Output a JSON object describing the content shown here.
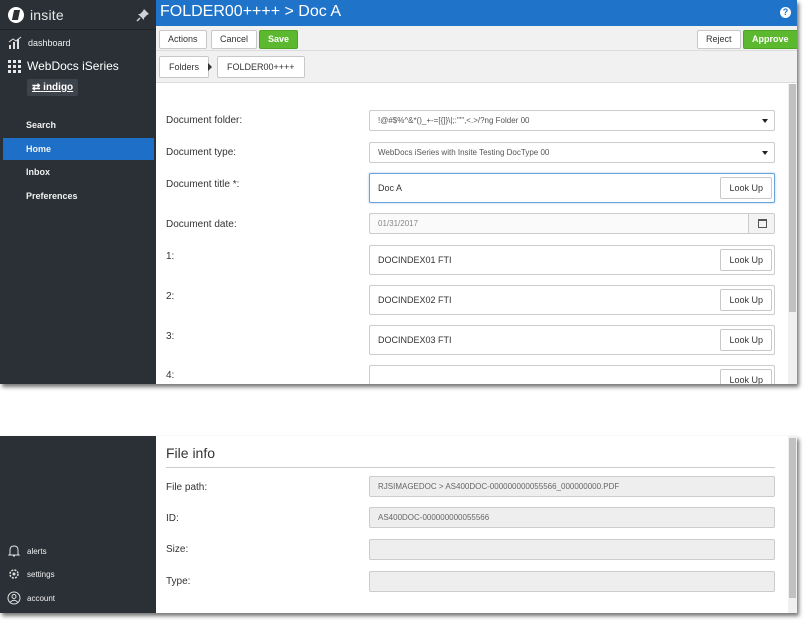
{
  "sidebar": {
    "logo_text": "insite",
    "dashboard_label": "dashboard",
    "app_name": "WebDocs iSeries",
    "environment": "indigo",
    "nav": [
      {
        "label": "Search"
      },
      {
        "label": "Home"
      },
      {
        "label": "Inbox"
      },
      {
        "label": "Preferences"
      }
    ],
    "bottom_nav": [
      {
        "label": "alerts",
        "icon": "bell-icon"
      },
      {
        "label": "settings",
        "icon": "gear-icon"
      },
      {
        "label": "account",
        "icon": "user-icon"
      }
    ]
  },
  "header": {
    "title": "FOLDER00++++ > Doc A",
    "help": "?"
  },
  "toolbar": {
    "actions_label": "Actions",
    "cancel_label": "Cancel",
    "save_label": "Save",
    "reject_label": "Reject",
    "approve_label": "Approve"
  },
  "breadcrumb": {
    "folders_label": "Folders",
    "current": "FOLDER00++++"
  },
  "form": {
    "folder_label": "Document folder:",
    "folder_value": "!@#$%^&*()_+-=[{]}\\|;:'\"\",<.>/?ng Folder 00",
    "type_label": "Document type:",
    "type_value": "WebDocs iSeries with Insite Testing DocType 00",
    "title_label": "Document title *:",
    "title_value": "Doc A",
    "date_label": "Document date:",
    "date_value": "01/31/2017",
    "lookup_label": "Look Up",
    "indexes": [
      {
        "label": "1:",
        "value": "DOCINDEX01 FTI"
      },
      {
        "label": "2:",
        "value": "DOCINDEX02 FTI"
      },
      {
        "label": "3:",
        "value": "DOCINDEX03 FTI"
      },
      {
        "label": "4:",
        "value": ""
      }
    ]
  },
  "file_info": {
    "title": "File info",
    "path_label": "File path:",
    "path_value": "RJSIMAGEDOC > AS400DOC-000000000055566_000000000.PDF",
    "id_label": "ID:",
    "id_value": "AS400DOC-000000000055566",
    "size_label": "Size:",
    "size_value": "",
    "type_label": "Type:",
    "type_value": ""
  },
  "colors": {
    "header_blue": "#1f73c9",
    "sidebar_bg": "#2a3036",
    "active_nav": "#1d6fc7",
    "approve_green": "#5cb82e"
  }
}
